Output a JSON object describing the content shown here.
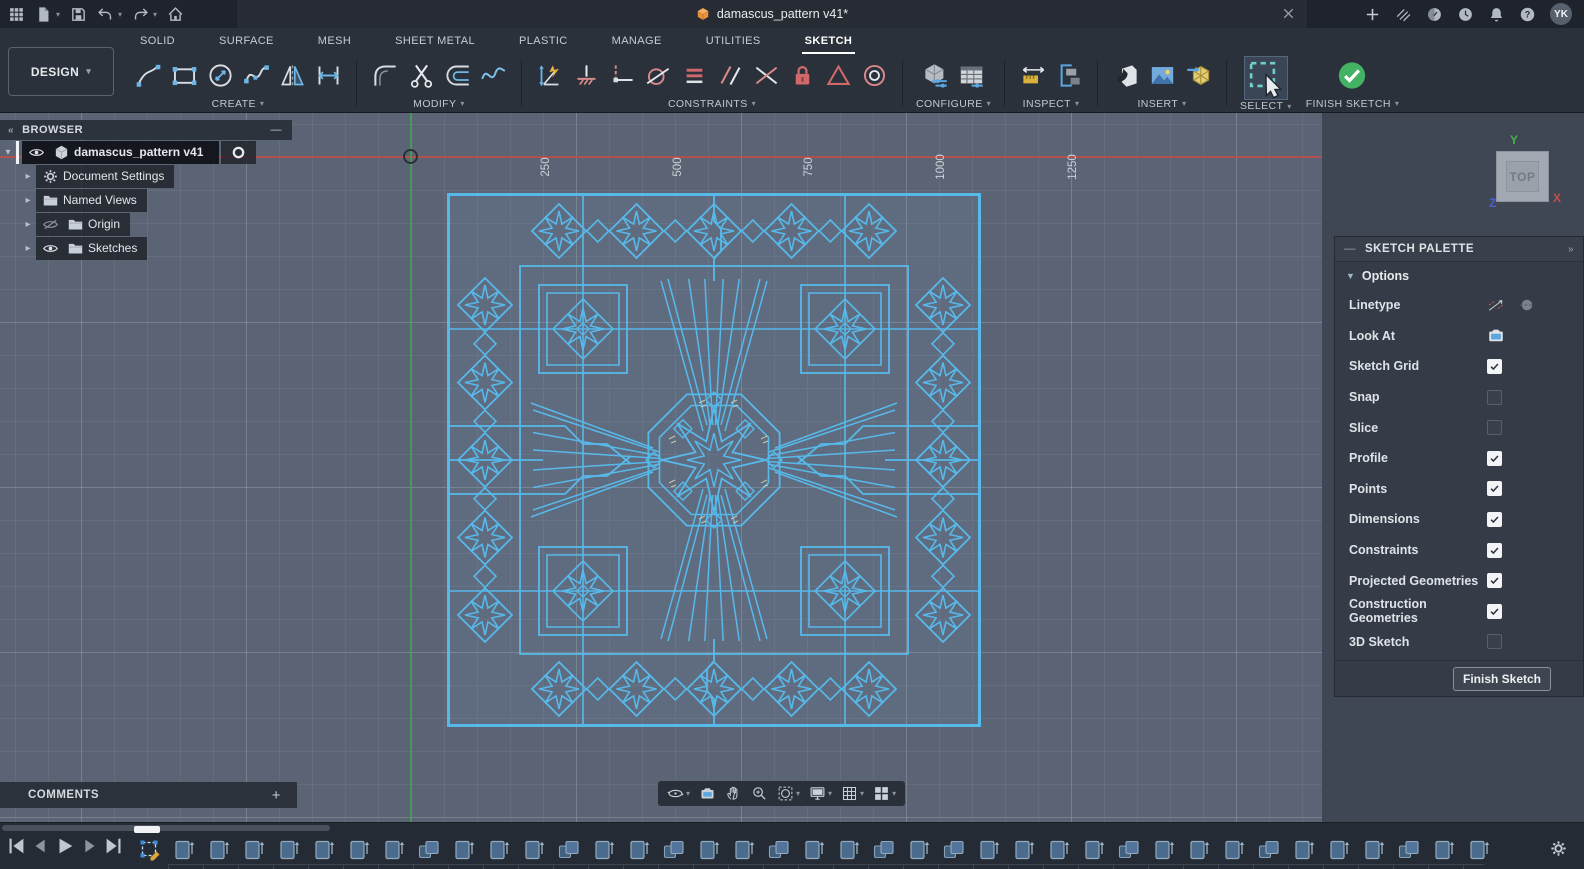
{
  "topbar": {
    "title": "damascus_pattern v41*",
    "close_label": "✕",
    "new_tab_label": "+",
    "avatar": "YK",
    "right_icons": [
      "job-status",
      "extensions",
      "clock",
      "notifications",
      "help"
    ],
    "left_icons": [
      "app-grid",
      "file-new",
      "save",
      "undo",
      "redo",
      "home"
    ]
  },
  "design_menu": {
    "label": "DESIGN"
  },
  "tabs": {
    "items": [
      "SOLID",
      "SURFACE",
      "MESH",
      "SHEET METAL",
      "PLASTIC",
      "MANAGE",
      "UTILITIES",
      "SKETCH"
    ],
    "active": "SKETCH"
  },
  "ribbon": {
    "groups": [
      {
        "label": "CREATE",
        "icons": [
          "sketch-line",
          "sketch-rectangle",
          "sketch-circle",
          "sketch-spline",
          "sketch-mirror",
          "sketch-dimension-tool"
        ]
      },
      {
        "label": "MODIFY",
        "icons": [
          "fillet",
          "trim",
          "offset",
          "break-curve"
        ]
      },
      {
        "label": "CONSTRAINTS",
        "icons": [
          "auto-dimension",
          "midpoint",
          "horizontal-vertical",
          "tangent",
          "equal",
          "parallel",
          "perpendicular",
          "fix-unfix",
          "symmetry",
          "concentric"
        ]
      },
      {
        "label": "CONFIGURE",
        "icons": [
          "configure-feature",
          "configuration-table"
        ]
      },
      {
        "label": "INSPECT",
        "icons": [
          "measure",
          "section-analysis"
        ]
      },
      {
        "label": "INSERT",
        "icons": [
          "insert-derive",
          "insert-image",
          "insert-mesh"
        ]
      },
      {
        "label": "SELECT",
        "icons": [
          "select-window"
        ]
      },
      {
        "label": "FINISH SKETCH",
        "icons": [
          "finish-sketch"
        ]
      }
    ]
  },
  "browser": {
    "header": "BROWSER",
    "collapse_icon": "«",
    "minimize_label": "—",
    "root": {
      "label": "damascus_pattern v41"
    },
    "items": [
      {
        "label": "Document Settings",
        "icon": "gear",
        "eye": "none"
      },
      {
        "label": "Named Views",
        "icon": "folder",
        "eye": "none"
      },
      {
        "label": "Origin",
        "icon": "folder",
        "eye": "off"
      },
      {
        "label": "Sketches",
        "icon": "folder",
        "eye": "on"
      }
    ]
  },
  "canvas": {
    "ruler_labels": [
      "250",
      "500",
      "750",
      "1000",
      "1250"
    ],
    "view_cube": {
      "face": "TOP",
      "axis_x": "X",
      "axis_y": "Y",
      "axis_z": "Z"
    }
  },
  "palette": {
    "title": "SKETCH PALETTE",
    "collapse_icon": "—",
    "expand_icon": "»",
    "section": "Options",
    "rows": [
      {
        "label": "Linetype",
        "type": "linetype"
      },
      {
        "label": "Look At",
        "type": "lookat"
      },
      {
        "label": "Sketch Grid",
        "type": "check",
        "checked": true
      },
      {
        "label": "Snap",
        "type": "check",
        "checked": false
      },
      {
        "label": "Slice",
        "type": "check",
        "checked": false
      },
      {
        "label": "Profile",
        "type": "check",
        "checked": true
      },
      {
        "label": "Points",
        "type": "check",
        "checked": true
      },
      {
        "label": "Dimensions",
        "type": "check",
        "checked": true
      },
      {
        "label": "Constraints",
        "type": "check",
        "checked": true
      },
      {
        "label": "Projected Geometries",
        "type": "check",
        "checked": true
      },
      {
        "label": "Construction Geometries",
        "type": "check",
        "checked": true
      },
      {
        "label": "3D Sketch",
        "type": "check",
        "checked": false
      }
    ],
    "finish_button": "Finish Sketch"
  },
  "comments": {
    "label": "COMMENTS",
    "add_label": "+"
  },
  "nav": {
    "items": [
      {
        "icon": "orbit",
        "dropdown": true
      },
      {
        "icon": "look-at-face",
        "dropdown": false
      },
      {
        "icon": "pan",
        "dropdown": false
      },
      {
        "icon": "zoom",
        "dropdown": false
      },
      {
        "icon": "fit",
        "dropdown": true
      },
      {
        "icon": "display-settings",
        "dropdown": true
      },
      {
        "icon": "grid-settings",
        "dropdown": true
      },
      {
        "icon": "viewports",
        "dropdown": true
      }
    ]
  },
  "timeline": {
    "features": [
      "extrude",
      "extrude",
      "extrude",
      "extrude",
      "extrude",
      "extrude",
      "extrude",
      "combine",
      "extrude",
      "extrude",
      "extrude",
      "combine",
      "extrude",
      "extrude",
      "combine",
      "extrude",
      "extrude",
      "combine",
      "extrude",
      "extrude",
      "combine",
      "extrude",
      "combine",
      "extrude",
      "extrude",
      "extrude",
      "extrude",
      "combine",
      "extrude",
      "extrude",
      "extrude",
      "combine",
      "extrude",
      "extrude",
      "extrude",
      "combine",
      "extrude",
      "extrude"
    ]
  },
  "colors": {
    "sketch_line": "#57b9ea",
    "profile_fill": "rgba(127,162,205,0.13)",
    "axis_x": "#bf4a46",
    "axis_y": "#3fa14f",
    "finish_green": "#43b264",
    "select_accent": "#6fd0c8"
  }
}
